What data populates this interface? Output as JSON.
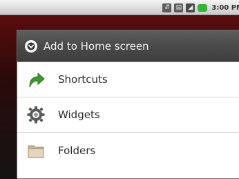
{
  "status_bar": {
    "time": "3:00 PM",
    "icons": [
      "usb-icon",
      "sd-card-icon",
      "signal-icon",
      "battery-icon"
    ]
  },
  "dialog": {
    "title": "Add to Home screen",
    "header_icon": "add-circle-icon",
    "items": [
      {
        "label": "Shortcuts",
        "icon": "green-arrow-icon"
      },
      {
        "label": "Widgets",
        "icon": "gear-icon"
      },
      {
        "label": "Folders",
        "icon": "folder-icon"
      }
    ]
  },
  "colors": {
    "header_bg": "#4a4a4a",
    "list_bg": "#ffffff",
    "battery_green": "#36b436",
    "arrow_green": "#3c9a2e"
  }
}
